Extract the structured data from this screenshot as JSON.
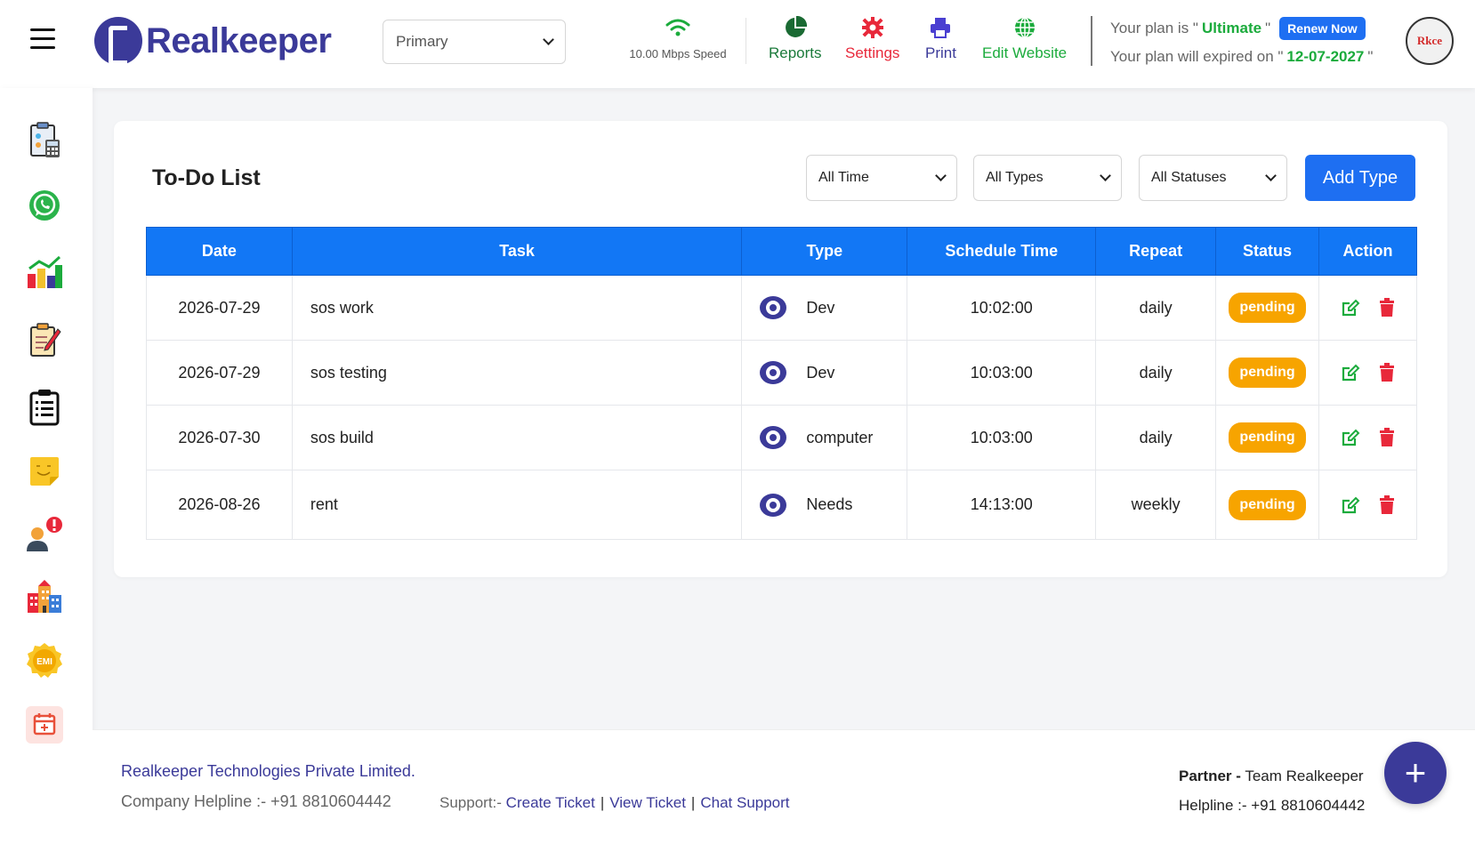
{
  "header": {
    "brand": "Realkeeper",
    "branch_select": "Primary",
    "speed": "10.00 Mbps Speed",
    "nav": {
      "reports": "Reports",
      "settings": "Settings",
      "print": "Print",
      "edit_website": "Edit Website"
    },
    "plan": {
      "prefix": "Your plan is \"",
      "name": "Ultimate",
      "suffix": "\"",
      "renew": "Renew Now",
      "expiry_prefix": "Your plan will expired on \"",
      "expiry_date": "12-07-2027",
      "expiry_suffix": "\""
    },
    "avatar_text": "Rkce"
  },
  "sidebar": {
    "items": [
      "calculator-icon",
      "whatsapp-icon",
      "analytics-icon",
      "notes-icon",
      "clipboard-icon",
      "sticky-note-icon",
      "user-alert-icon",
      "buildings-icon",
      "emi-icon",
      "calendar-icon"
    ],
    "emi_label": "EMI"
  },
  "todo": {
    "title": "To-Do List",
    "filters": {
      "time": "All Time",
      "types": "All Types",
      "statuses": "All Statuses"
    },
    "add_type": "Add Type",
    "columns": [
      "Date",
      "Task",
      "Type",
      "Schedule Time",
      "Repeat",
      "Status",
      "Action"
    ],
    "rows": [
      {
        "date": "2026-07-29",
        "task": "sos work",
        "type": "Dev",
        "time": "10:02:00",
        "repeat": "daily",
        "status": "pending"
      },
      {
        "date": "2026-07-29",
        "task": "sos testing",
        "type": "Dev",
        "time": "10:03:00",
        "repeat": "daily",
        "status": "pending"
      },
      {
        "date": "2026-07-30",
        "task": "sos build",
        "type": "computer",
        "time": "10:03:00",
        "repeat": "daily",
        "status": "pending"
      },
      {
        "date": "2026-08-26",
        "task": "rent",
        "type": "Needs",
        "time": "14:13:00",
        "repeat": "weekly",
        "status": "pending"
      }
    ]
  },
  "footer": {
    "company": "Realkeeper Technologies Private Limited.",
    "helpline": "Company Helpline :- +91 8810604442",
    "support_label": "Support:-",
    "create_ticket": "Create Ticket",
    "view_ticket": "View Ticket",
    "chat_support": "Chat Support",
    "link_sep": "|",
    "partner_label": "Partner -",
    "partner_name": "Team Realkeeper",
    "partner_helpline": "Helpline :- +91 8810604442"
  },
  "colors": {
    "brand": "#3b3a99",
    "accent": "#1e6ff2",
    "table_header": "#1277f5",
    "pending": "#f7a400",
    "success": "#1bab3c",
    "danger": "#e8283a"
  }
}
